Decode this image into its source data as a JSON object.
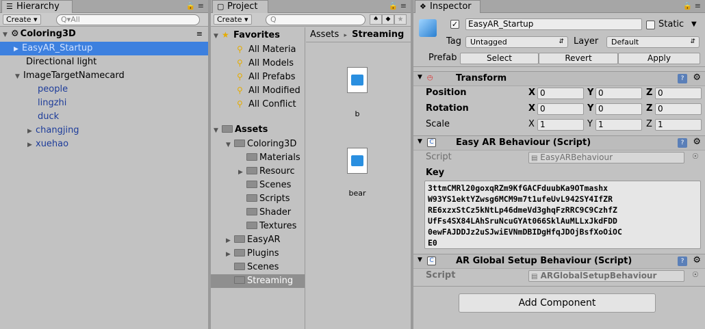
{
  "hierarchy": {
    "tab_label": "Hierarchy",
    "tab_controls": "≡",
    "create_label": "Create ▾",
    "search_placeholder": "All",
    "search_prefix": "Q▾",
    "scene_name": "Coloring3D",
    "items": [
      {
        "label": "EasyAR_Startup"
      },
      {
        "label": "Directional light"
      },
      {
        "label": "ImageTargetNamecard"
      },
      {
        "label": "people"
      },
      {
        "label": "lingzhi"
      },
      {
        "label": "duck"
      },
      {
        "label": "changjing"
      },
      {
        "label": "xuehao"
      }
    ]
  },
  "project": {
    "tab_label": "Project",
    "create_label": "Create ▾",
    "search_prefix": "Q",
    "favorites_label": "Favorites",
    "favorites": [
      "All Materia",
      "All Models",
      "All Prefabs",
      "All Modified",
      "All Conflict"
    ],
    "assets_label": "Assets",
    "tree": [
      "Coloring3D",
      "Materials",
      "Resourc",
      "Scenes",
      "Scripts",
      "Shader",
      "Textures",
      "EasyAR",
      "Plugins",
      "Scenes",
      "Streaming"
    ],
    "breadcrumb_root": "Assets",
    "breadcrumb_sep": "▸",
    "breadcrumb_current": "Streaming",
    "files": [
      "b",
      "bear"
    ]
  },
  "inspector": {
    "tab_label": "Inspector",
    "object_name": "EasyAR_Startup",
    "static_label": "Static",
    "tag_label": "Tag",
    "tag_value": "Untagged",
    "layer_label": "Layer",
    "layer_value": "Default",
    "prefab_label": "Prefab",
    "prefab_buttons": [
      "Select",
      "Revert",
      "Apply"
    ],
    "transform": {
      "title": "Transform",
      "rows": [
        {
          "label": "Position",
          "x": "0",
          "y": "0",
          "z": "0"
        },
        {
          "label": "Rotation",
          "x": "0",
          "y": "0",
          "z": "0"
        },
        {
          "label": "Scale",
          "x": "1",
          "y": "1",
          "z": "1"
        }
      ],
      "axis_x": "X",
      "axis_y": "Y",
      "axis_z": "Z"
    },
    "easyar": {
      "title": "Easy AR Behaviour (Script)",
      "script_label": "Script",
      "script_value": "EasyARBehaviour",
      "key_label": "Key",
      "key_lines": [
        "3ttmCMRl20goxqRZm9KfGACFduubKa9OTmashx",
        "W93YS1ektYZwsg6MCM9m7t1ufeUvL942SY4IfZR",
        "RE6xzxStCz5kNtLp46dmeVd3ghqFzRRC9C9CzhfZ",
        "UfFs4SX84LAhSruNcuGYAt066SklAuMLLxJkdFDD",
        "0ewFAJDDJz2uSJwiEVNmDBIDgHfqJDOjBsfXoOiOC",
        "E0"
      ]
    },
    "arglobal": {
      "title": "AR Global Setup Behaviour (Script)",
      "script_label": "Script",
      "script_value": "ARGlobalSetupBehaviour"
    },
    "add_component_label": "Add Component"
  }
}
